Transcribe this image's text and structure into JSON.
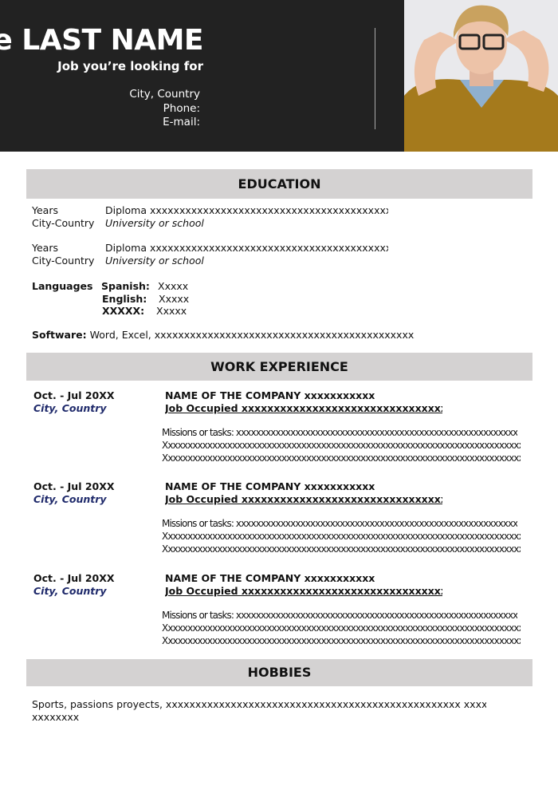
{
  "header": {
    "name": "Name LAST NAME",
    "job": "Job you’re looking for",
    "city": "City, Country",
    "phone": "Phone:",
    "email": "E-mail:"
  },
  "education": {
    "title": "EDUCATION",
    "entries": [
      {
        "years": "Years",
        "location": "City-Country",
        "diploma": "Diploma xxxxxxxxxxxxxxxxxxxxxxxxxxxxxxxxxxxxxxxxxxxxxxxxxxxxxxx",
        "school": "University or school"
      },
      {
        "years": "Years",
        "location": "City-Country",
        "diploma": "Diploma xxxxxxxxxxxxxxxxxxxxxxxxxxxxxxxxxxxxxxxxxxxxxxxxxxxxxxx",
        "school": "University or school"
      }
    ],
    "languages_label": "Languages",
    "languages": [
      {
        "name": "Spanish:",
        "level": "Xxxxx"
      },
      {
        "name": "English:",
        "level": "Xxxxx"
      },
      {
        "name": "XXXXX:",
        "level": "Xxxxx"
      }
    ],
    "software_label": "Software:",
    "software": "Word, Excel, xxxxxxxxxxxxxxxxxxxxxxxxxxxxxxxxxxxxxxxxxxxxxxxxxxxxxxxxxxxxxxx"
  },
  "work": {
    "title": "WORK EXPERIENCE",
    "entries": [
      {
        "dates": "Oct. - Jul 20XX",
        "location": "City, Country",
        "company": "NAME OF THE COMPANY xxxxxxxxxxx",
        "job": "Job Occupied xxxxxxxxxxxxxxxxxxxxxxxxxxxxxxxxxxxx",
        "tasks": [
          "Missions or tasks: xxxxxxxxxxxxxxxxxxxxxxxxxxxxxxxxxxxxxxxxxxxxxxxxxxxxxxxxxxxxxxxxxxxxx",
          "Xxxxxxxxxxxxxxxxxxxxxxxxxxxxxxxxxxxxxxxxxxxxxxxxxxxxxxxxxxxxxxxxxxxxxxxxxxxxxxxxxxxxxxxxxx",
          "Xxxxxxxxxxxxxxxxxxxxxxxxxxxxxxxxxxxxxxxxxxxxxxxxxxxxxxxxxxxxxxxxxxxxxxxxxxxxxxxxxxxxxxxxxx"
        ]
      },
      {
        "dates": "Oct. - Jul 20XX",
        "location": "City, Country",
        "company": "NAME OF THE COMPANY xxxxxxxxxxx",
        "job": "Job Occupied xxxxxxxxxxxxxxxxxxxxxxxxxxxxxxxxxxxx",
        "tasks": [
          "Missions or tasks: xxxxxxxxxxxxxxxxxxxxxxxxxxxxxxxxxxxxxxxxxxxxxxxxxxxxxxxxxxxxxxxxxxxxx",
          "Xxxxxxxxxxxxxxxxxxxxxxxxxxxxxxxxxxxxxxxxxxxxxxxxxxxxxxxxxxxxxxxxxxxxxxxxxxxxxxxxxxxxxxxxxx",
          "Xxxxxxxxxxxxxxxxxxxxxxxxxxxxxxxxxxxxxxxxxxxxxxxxxxxxxxxxxxxxxxxxxxxxxxxxxxxxxxxxxxxxxxxxxx"
        ]
      },
      {
        "dates": "Oct. - Jul 20XX",
        "location": "City, Country",
        "company": "NAME OF THE COMPANY xxxxxxxxxxx",
        "job": "Job Occupied xxxxxxxxxxxxxxxxxxxxxxxxxxxxxxxxxxxx",
        "tasks": [
          "Missions or tasks: xxxxxxxxxxxxxxxxxxxxxxxxxxxxxxxxxxxxxxxxxxxxxxxxxxxxxxxxxxxxxxxxxxxxx",
          "Xxxxxxxxxxxxxxxxxxxxxxxxxxxxxxxxxxxxxxxxxxxxxxxxxxxxxxxxxxxxxxxxxxxxxxxxxxxxxxxxxxxxxxxxxx",
          "Xxxxxxxxxxxxxxxxxxxxxxxxxxxxxxxxxxxxxxxxxxxxxxxxxxxxxxxxxxxxxxxxxxxxxxxxxxxxxxxxxxxxxxxxxx"
        ]
      }
    ]
  },
  "hobbies": {
    "title": "HOBBIES",
    "line1": "Sports, passions proyects, xxxxxxxxxxxxxxxxxxxxxxxxxxxxxxxxxxxxxxxxxxxxxxxxxx xxxxxxxxxxxxxxxxxxx",
    "line2": "xxxxxxxx"
  }
}
